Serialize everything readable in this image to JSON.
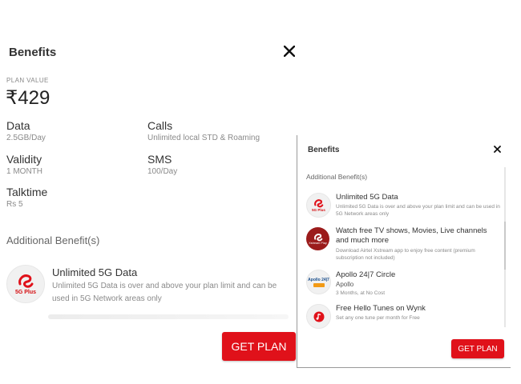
{
  "left": {
    "title": "Benefits",
    "plan_value_label": "PLAN VALUE",
    "price": "₹429",
    "details": [
      {
        "label": "Data",
        "value": "2.5GB/Day"
      },
      {
        "label": "Calls",
        "value": "Unlimited local STD & Roaming"
      },
      {
        "label": "Validity",
        "value": "1 MONTH"
      },
      {
        "label": "SMS",
        "value": "100/Day"
      },
      {
        "label": "Talktime",
        "value": "Rs 5"
      }
    ],
    "additional_heading": "Additional Benefit(s)",
    "benefit": {
      "title": "Unlimited 5G Data",
      "desc_line1": "Unlimited 5G Data is over and above your plan limit and can be",
      "desc_line2": "used in 5G Network areas only",
      "logo_text": "5G Plus"
    },
    "cta": "GET PLAN"
  },
  "panel": {
    "title": "Benefits",
    "additional_heading": "Additional Benefit(s)",
    "items": [
      {
        "title": "Unlimited 5G Data",
        "desc": "Unlimited 5G Data is over and above your plan limit and can be used in 5G Network areas only",
        "logo_text": "5G Plus",
        "icon": "airtel-5g-logo"
      },
      {
        "title": "Watch free TV shows, Movies, Live channels and much more",
        "desc": "Download Airtel Xstream app to enjoy free content (premium subscription not included)",
        "logo_text": "Xstream Play",
        "icon": "xstream-logo"
      },
      {
        "title": "Apollo 24|7 Circle",
        "subtitle": "Apollo",
        "desc": "3 Months, at No Cost",
        "logo_text": "Apollo 24|7",
        "icon": "apollo-logo"
      },
      {
        "title": "Free Hello Tunes on Wynk",
        "desc": "Set any one tune per month for Free",
        "icon": "wynk-logo"
      }
    ],
    "cta": "GET PLAN"
  },
  "colors": {
    "brand_red": "#e0111a",
    "muted_text": "#8a8a8a"
  }
}
